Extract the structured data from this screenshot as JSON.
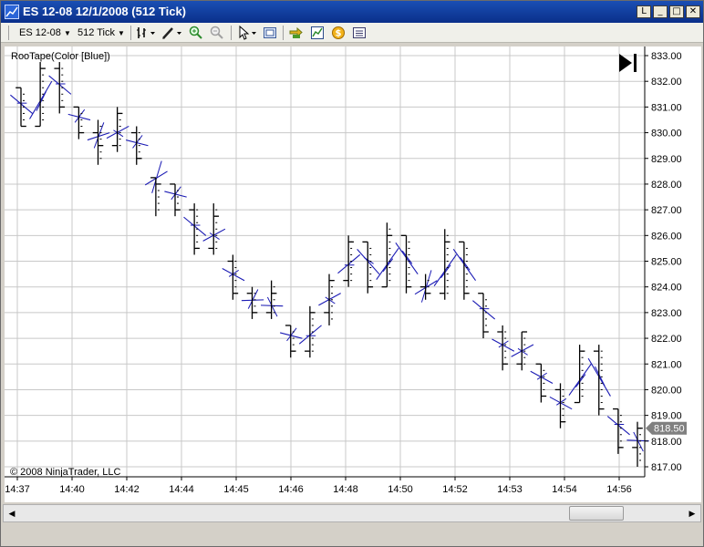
{
  "window": {
    "title": "ES 12-08  12/1/2008 (512 Tick)",
    "buttons": {
      "link": "L",
      "minimize": "_",
      "maximize": "□",
      "close": "✕"
    }
  },
  "toolbar": {
    "instrument": "ES 12-08",
    "interval": "512 Tick",
    "icons": [
      "bar-type-icon",
      "drawing-pencil-icon",
      "zoom-in-icon",
      "zoom-out-icon",
      "pointer-icon",
      "data-box-icon",
      "instrument-swap-icon",
      "chart-indicators-icon",
      "strategy-icon",
      "properties-icon"
    ]
  },
  "chart": {
    "indicator_label": "RooTape(Color [Blue])",
    "copyright": "© 2008 NinjaTrader, LLC",
    "last_price": "818.50",
    "series_color": "#1a1ab4",
    "bar_color": "#000000",
    "grid_color": "#c8c8c8",
    "price_marker_color": "#808080"
  },
  "chart_data": {
    "type": "bar",
    "title": "",
    "xlabel": "",
    "ylabel": "",
    "ylim": [
      816.75,
      833.25
    ],
    "yticks": [
      "833.00",
      "832.00",
      "831.00",
      "830.00",
      "829.00",
      "828.00",
      "827.00",
      "826.00",
      "825.00",
      "824.00",
      "823.00",
      "822.00",
      "821.00",
      "820.00",
      "819.00",
      "818.00",
      "817.00"
    ],
    "xticks": [
      "14:37",
      "14:40",
      "14:42",
      "14:44",
      "14:45",
      "14:46",
      "14:48",
      "14:50",
      "14:52",
      "14:53",
      "14:54",
      "14:56"
    ],
    "bars": [
      {
        "o": 831.75,
        "h": 831.75,
        "l": 830.25,
        "c": 830.25
      },
      {
        "o": 830.25,
        "h": 832.75,
        "l": 830.25,
        "c": 832.5
      },
      {
        "o": 832.5,
        "h": 832.75,
        "l": 830.75,
        "c": 831.0
      },
      {
        "o": 831.0,
        "h": 831.0,
        "l": 829.75,
        "c": 830.0
      },
      {
        "o": 830.0,
        "h": 830.5,
        "l": 828.75,
        "c": 829.5
      },
      {
        "o": 829.5,
        "h": 831.0,
        "l": 829.25,
        "c": 830.75
      },
      {
        "o": 830.0,
        "h": 830.25,
        "l": 828.75,
        "c": 829.0
      },
      {
        "o": 828.25,
        "h": 828.25,
        "l": 826.75,
        "c": 828.0
      },
      {
        "o": 828.0,
        "h": 828.0,
        "l": 826.75,
        "c": 827.0
      },
      {
        "o": 827.0,
        "h": 827.25,
        "l": 825.25,
        "c": 825.5
      },
      {
        "o": 825.5,
        "h": 827.25,
        "l": 825.25,
        "c": 826.75
      },
      {
        "o": 825.0,
        "h": 825.25,
        "l": 823.5,
        "c": 823.75
      },
      {
        "o": 823.75,
        "h": 824.0,
        "l": 822.75,
        "c": 823.0
      },
      {
        "o": 823.0,
        "h": 824.25,
        "l": 822.75,
        "c": 823.75
      },
      {
        "o": 822.5,
        "h": 822.5,
        "l": 821.25,
        "c": 821.5
      },
      {
        "o": 821.5,
        "h": 823.25,
        "l": 821.25,
        "c": 823.0
      },
      {
        "o": 823.0,
        "h": 824.5,
        "l": 822.5,
        "c": 824.25
      },
      {
        "o": 824.25,
        "h": 826.0,
        "l": 824.0,
        "c": 825.75
      },
      {
        "o": 825.75,
        "h": 825.75,
        "l": 823.75,
        "c": 824.0
      },
      {
        "o": 824.0,
        "h": 826.5,
        "l": 824.0,
        "c": 826.0
      },
      {
        "o": 826.0,
        "h": 826.0,
        "l": 823.75,
        "c": 824.0
      },
      {
        "o": 824.0,
        "h": 824.5,
        "l": 823.5,
        "c": 823.75
      },
      {
        "o": 823.75,
        "h": 826.25,
        "l": 823.5,
        "c": 825.75
      },
      {
        "o": 825.75,
        "h": 825.75,
        "l": 823.5,
        "c": 823.75
      },
      {
        "o": 823.75,
        "h": 823.75,
        "l": 822.0,
        "c": 822.25
      },
      {
        "o": 822.25,
        "h": 822.5,
        "l": 820.75,
        "c": 821.0
      },
      {
        "o": 821.0,
        "h": 822.25,
        "l": 820.75,
        "c": 822.25
      },
      {
        "o": 821.0,
        "h": 821.0,
        "l": 819.5,
        "c": 819.75
      },
      {
        "o": 820.0,
        "h": 820.25,
        "l": 818.5,
        "c": 818.75
      },
      {
        "o": 819.5,
        "h": 821.75,
        "l": 819.5,
        "c": 821.5
      },
      {
        "o": 821.5,
        "h": 821.75,
        "l": 819.0,
        "c": 819.25
      },
      {
        "o": 819.25,
        "h": 819.25,
        "l": 817.5,
        "c": 817.75
      },
      {
        "o": 817.75,
        "h": 818.75,
        "l": 817.0,
        "c": 818.5
      }
    ]
  }
}
